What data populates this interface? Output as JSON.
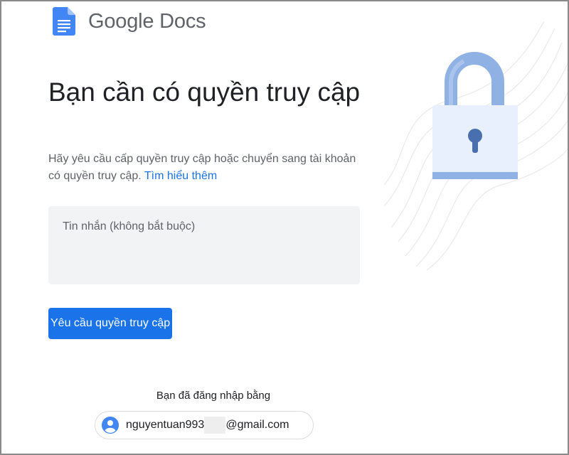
{
  "header": {
    "app_name": "Google Docs",
    "logo_icon": "google-docs-icon"
  },
  "main": {
    "title": "Bạn cần có quyền truy cập",
    "description": "Hãy yêu cầu cấp quyền truy cập hoặc chuyển sang tài khoản có quyền truy cập.",
    "learn_more_link": "Tìm hiểu thêm",
    "message_placeholder": "Tin nhắn (không bắt buộc)",
    "message_value": "",
    "request_button": "Yêu cầu quyền truy cập"
  },
  "account": {
    "signed_in_label": "Bạn đã đăng nhập bằng",
    "email_prefix": "nguyentuan993",
    "email_suffix": "@gmail.com",
    "avatar_icon": "account-circle-icon"
  },
  "illustration": {
    "icon": "padlock-icon"
  },
  "colors": {
    "accent": "#1a73e8",
    "input_bg": "#f1f3f4",
    "lock_shackle": "#8fb1e3",
    "lock_body": "#e8f0fe"
  }
}
